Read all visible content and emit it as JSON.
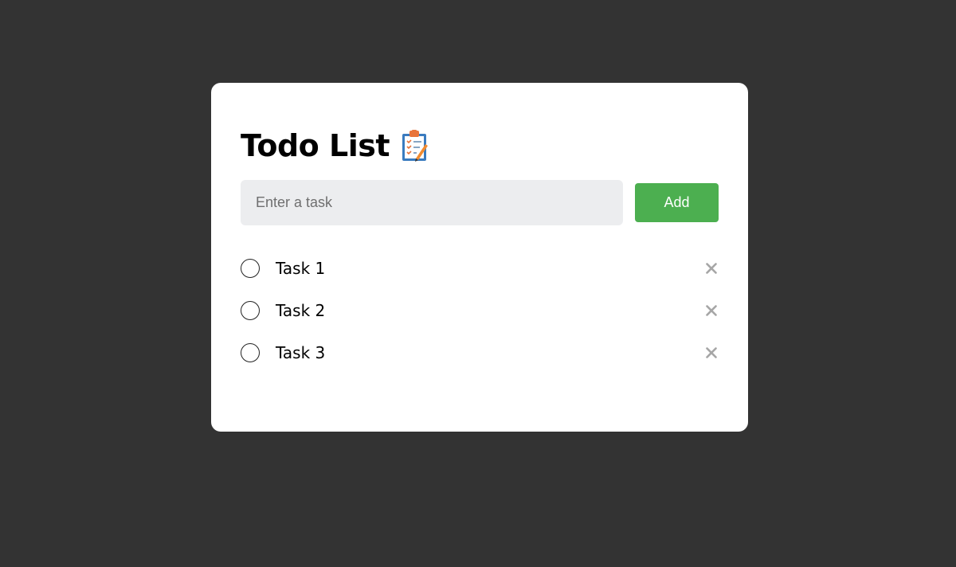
{
  "app": {
    "title": "Todo List",
    "title_icon": "clipboard-icon"
  },
  "input": {
    "placeholder": "Enter a task",
    "value": ""
  },
  "actions": {
    "add_label": "Add"
  },
  "tasks": [
    {
      "label": "Task 1",
      "completed": false
    },
    {
      "label": "Task 2",
      "completed": false
    },
    {
      "label": "Task 3",
      "completed": false
    }
  ],
  "colors": {
    "background": "#333333",
    "card": "#ffffff",
    "accent": "#4caf50",
    "input_bg": "#ecedef",
    "delete_icon": "#a6a6a6"
  }
}
